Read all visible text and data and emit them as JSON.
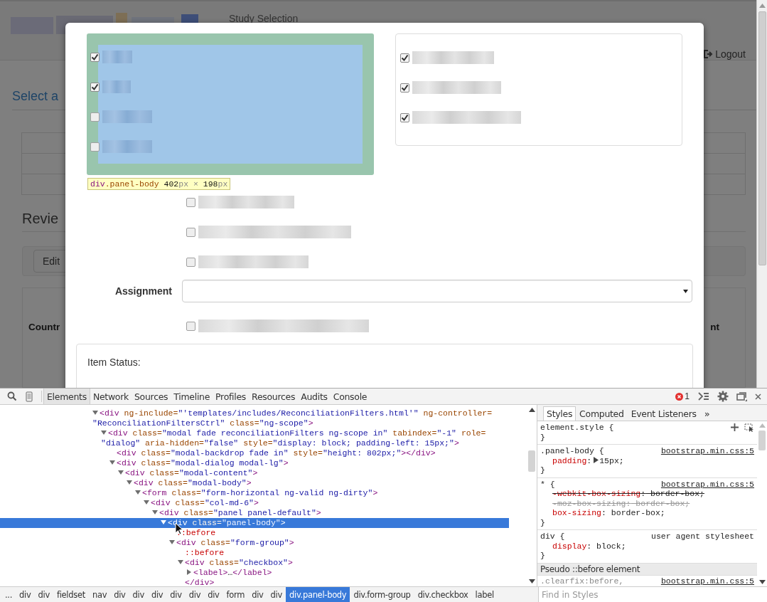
{
  "page": {
    "header": {
      "title": "Study Selection",
      "logout": "Logout"
    },
    "heading": "Select a",
    "section_title": "Revie",
    "edit_button": "Edit",
    "table": {
      "columns": [
        {
          "label": "Countr"
        },
        {
          "label": "nt"
        }
      ]
    }
  },
  "modal": {
    "left_panel": {
      "items": [
        {
          "checked": true
        },
        {
          "checked": true
        },
        {
          "checked": false
        },
        {
          "checked": false
        }
      ]
    },
    "highlight_tooltip": {
      "parts": [
        {
          "kind": "tag",
          "text": "div"
        },
        {
          "kind": "class",
          "text": ".panel-body "
        },
        {
          "kind": "number",
          "text": "402"
        },
        {
          "kind": "unit",
          "text": "px × "
        },
        {
          "kind": "number",
          "text": "198"
        },
        {
          "kind": "unit",
          "text": "px"
        }
      ]
    },
    "right_panel": {
      "items": [
        {
          "checked": true
        },
        {
          "checked": true
        },
        {
          "checked": true
        }
      ]
    },
    "options": [
      {
        "checked": false
      },
      {
        "checked": false
      },
      {
        "checked": false
      }
    ],
    "assignment": {
      "label": "Assignment"
    },
    "extra_option": {
      "checked": false
    },
    "item_status": {
      "label": "Item Status:"
    }
  },
  "devtools": {
    "tabs": [
      {
        "label": "Elements",
        "selected": true
      },
      {
        "label": "Network",
        "selected": false
      },
      {
        "label": "Sources",
        "selected": false
      },
      {
        "label": "Timeline",
        "selected": false
      },
      {
        "label": "Profiles",
        "selected": false
      },
      {
        "label": "Resources",
        "selected": false
      },
      {
        "label": "Audits",
        "selected": false
      },
      {
        "label": "Console",
        "selected": false
      }
    ],
    "error_count": "1",
    "dom_tree": [
      {
        "kind": "element",
        "expanded": true,
        "selected": false,
        "tokens": [
          {
            "kind": "tag",
            "text": "<div"
          },
          {
            "kind": "attr",
            "text": " ng-include="
          },
          {
            "kind": "value",
            "text": "\"'templates/includes/ReconciliationFilters.html'\""
          },
          {
            "kind": "attr",
            "text": " ng-controller="
          },
          {
            "kind": "value",
            "text": "\"ReconciliationFiltersCtrl\""
          },
          {
            "kind": "attr",
            "text": " class="
          },
          {
            "kind": "value",
            "text": "\"ng-scope\""
          },
          {
            "kind": "tag",
            "text": ">"
          }
        ],
        "children": [
          {
            "kind": "element",
            "expanded": true,
            "selected": false,
            "tokens": [
              {
                "kind": "tag",
                "text": "<div"
              },
              {
                "kind": "attr",
                "text": " class="
              },
              {
                "kind": "value",
                "text": "\"modal fade reconciliationFilters ng-scope in\""
              },
              {
                "kind": "attr",
                "text": " tabindex="
              },
              {
                "kind": "value",
                "text": "\"-1\""
              },
              {
                "kind": "attr",
                "text": " role="
              },
              {
                "kind": "value",
                "text": "\"dialog\""
              },
              {
                "kind": "attr",
                "text": " aria-hidden="
              },
              {
                "kind": "value",
                "text": "\"false\""
              },
              {
                "kind": "attr",
                "text": " style="
              },
              {
                "kind": "value",
                "text": "\"display: block; padding-left: 15px;\""
              },
              {
                "kind": "tag",
                "text": ">"
              }
            ],
            "children": [
              {
                "kind": "leaf",
                "selected": false,
                "tokens": [
                  {
                    "kind": "tag",
                    "text": "<div"
                  },
                  {
                    "kind": "attr",
                    "text": " class="
                  },
                  {
                    "kind": "value",
                    "text": "\"modal-backdrop fade in\""
                  },
                  {
                    "kind": "attr",
                    "text": " style="
                  },
                  {
                    "kind": "value",
                    "text": "\"height: 802px;\""
                  },
                  {
                    "kind": "tag",
                    "text": "></div>"
                  }
                ]
              },
              {
                "kind": "element",
                "expanded": true,
                "selected": false,
                "tokens": [
                  {
                    "kind": "tag",
                    "text": "<div"
                  },
                  {
                    "kind": "attr",
                    "text": " class="
                  },
                  {
                    "kind": "value",
                    "text": "\"modal-dialog modal-lg\""
                  },
                  {
                    "kind": "tag",
                    "text": ">"
                  }
                ],
                "children": [
                  {
                    "kind": "element",
                    "expanded": true,
                    "selected": false,
                    "tokens": [
                      {
                        "kind": "tag",
                        "text": "<div"
                      },
                      {
                        "kind": "attr",
                        "text": " class="
                      },
                      {
                        "kind": "value",
                        "text": "\"modal-content\""
                      },
                      {
                        "kind": "tag",
                        "text": ">"
                      }
                    ],
                    "children": [
                      {
                        "kind": "element",
                        "expanded": true,
                        "selected": false,
                        "tokens": [
                          {
                            "kind": "tag",
                            "text": "<div"
                          },
                          {
                            "kind": "attr",
                            "text": " class="
                          },
                          {
                            "kind": "value",
                            "text": "\"modal-body\""
                          },
                          {
                            "kind": "tag",
                            "text": ">"
                          }
                        ],
                        "children": [
                          {
                            "kind": "element",
                            "expanded": true,
                            "selected": false,
                            "tokens": [
                              {
                                "kind": "tag",
                                "text": "<form"
                              },
                              {
                                "kind": "attr",
                                "text": " class="
                              },
                              {
                                "kind": "value",
                                "text": "\"form-horizontal ng-valid ng-dirty\""
                              },
                              {
                                "kind": "tag",
                                "text": ">"
                              }
                            ],
                            "children": [
                              {
                                "kind": "element",
                                "expanded": true,
                                "selected": false,
                                "tokens": [
                                  {
                                    "kind": "tag",
                                    "text": "<div"
                                  },
                                  {
                                    "kind": "attr",
                                    "text": " class="
                                  },
                                  {
                                    "kind": "value",
                                    "text": "\"col-md-6\""
                                  },
                                  {
                                    "kind": "tag",
                                    "text": ">"
                                  }
                                ],
                                "children": [
                                  {
                                    "kind": "element",
                                    "expanded": true,
                                    "selected": false,
                                    "tokens": [
                                      {
                                        "kind": "tag",
                                        "text": "<div"
                                      },
                                      {
                                        "kind": "attr",
                                        "text": " class="
                                      },
                                      {
                                        "kind": "value",
                                        "text": "\"panel panel-default\""
                                      },
                                      {
                                        "kind": "tag",
                                        "text": ">"
                                      }
                                    ],
                                    "children": [
                                      {
                                        "kind": "element",
                                        "expanded": true,
                                        "selected": true,
                                        "tokens": [
                                          {
                                            "kind": "tag",
                                            "text": "<div"
                                          },
                                          {
                                            "kind": "attr",
                                            "text": " class="
                                          },
                                          {
                                            "kind": "value",
                                            "text": "\"panel-body\""
                                          },
                                          {
                                            "kind": "tag",
                                            "text": ">"
                                          }
                                        ],
                                        "children": [
                                          {
                                            "kind": "leaf",
                                            "selected": false,
                                            "tokens": [
                                              {
                                                "kind": "pseudo",
                                                "text": "::before"
                                              }
                                            ]
                                          },
                                          {
                                            "kind": "element",
                                            "expanded": true,
                                            "selected": false,
                                            "tokens": [
                                              {
                                                "kind": "tag",
                                                "text": "<div"
                                              },
                                              {
                                                "kind": "attr",
                                                "text": " class="
                                              },
                                              {
                                                "kind": "value",
                                                "text": "\"form-group\""
                                              },
                                              {
                                                "kind": "tag",
                                                "text": ">"
                                              }
                                            ],
                                            "children": [
                                              {
                                                "kind": "leaf",
                                                "selected": false,
                                                "tokens": [
                                                  {
                                                    "kind": "pseudo",
                                                    "text": "::before"
                                                  }
                                                ]
                                              },
                                              {
                                                "kind": "element",
                                                "expanded": true,
                                                "selected": false,
                                                "tokens": [
                                                  {
                                                    "kind": "tag",
                                                    "text": "<div"
                                                  },
                                                  {
                                                    "kind": "attr",
                                                    "text": " class="
                                                  },
                                                  {
                                                    "kind": "value",
                                                    "text": "\"checkbox\""
                                                  },
                                                  {
                                                    "kind": "tag",
                                                    "text": ">"
                                                  }
                                                ],
                                                "close": [
                                                  {
                                                    "kind": "tag",
                                                    "text": "</div>"
                                                  }
                                                ],
                                                "children": [
                                                  {
                                                    "kind": "element",
                                                    "expanded": false,
                                                    "selected": false,
                                                    "tokens": [
                                                      {
                                                        "kind": "tag",
                                                        "text": "<label>"
                                                      },
                                                      {
                                                        "kind": "text",
                                                        "text": "…"
                                                      },
                                                      {
                                                        "kind": "tag",
                                                        "text": "</label>"
                                                      }
                                                    ]
                                                  }
                                                ]
                                              }
                                            ]
                                          }
                                        ]
                                      }
                                    ]
                                  }
                                ]
                              }
                            ]
                          }
                        ]
                      }
                    ]
                  }
                ]
              }
            ]
          }
        ]
      }
    ],
    "breadcrumbs": [
      {
        "label": "...",
        "selected": false
      },
      {
        "label": "div",
        "selected": false
      },
      {
        "label": "div",
        "selected": false
      },
      {
        "label": "fieldset",
        "selected": false
      },
      {
        "label": "nav",
        "selected": false
      },
      {
        "label": "div",
        "selected": false
      },
      {
        "label": "div",
        "selected": false
      },
      {
        "label": "div",
        "selected": false
      },
      {
        "label": "div",
        "selected": false
      },
      {
        "label": "div",
        "selected": false
      },
      {
        "label": "div",
        "selected": false
      },
      {
        "label": "form",
        "selected": false
      },
      {
        "label": "div",
        "selected": false
      },
      {
        "label": "div",
        "selected": false
      },
      {
        "label": "div.panel-body",
        "selected": true
      },
      {
        "label": "div.form-group",
        "selected": false
      },
      {
        "label": "div.checkbox",
        "selected": false
      },
      {
        "label": "label",
        "selected": false
      }
    ],
    "styles_tabs": [
      {
        "label": "Styles",
        "selected": true
      },
      {
        "label": "Computed",
        "selected": false
      },
      {
        "label": "Event Listeners",
        "selected": false
      }
    ],
    "styles_more": "»",
    "rules": [
      {
        "header": "element.style {",
        "tools": true,
        "footer": "}"
      },
      {
        "header": ".panel-body {",
        "source": "bootstrap.min.css:5",
        "underlined": true,
        "declarations": [
          {
            "name": "padding",
            "colon": ":",
            "value": "15px;",
            "expandable": true,
            "struck": false,
            "invalid": false
          }
        ],
        "footer": "}"
      },
      {
        "header": "* {",
        "source": "bootstrap.min.css:5",
        "underlined": true,
        "declarations": [
          {
            "name": "-webkit-box-sizing",
            "colon": ":",
            "value": " border-box;",
            "expandable": false,
            "struck": true,
            "invalid": false
          },
          {
            "name": "-moz-box-sizing",
            "colon": ":",
            "value": " border-box;",
            "expandable": false,
            "struck": true,
            "invalid": true
          },
          {
            "name": "box-sizing",
            "colon": ":",
            "value": " border-box;",
            "expandable": false,
            "struck": false,
            "invalid": false
          }
        ],
        "footer": "}"
      },
      {
        "header": "div {",
        "source": "user agent stylesheet",
        "underlined": false,
        "declarations": [
          {
            "name": "display",
            "colon": ":",
            "value": " block;",
            "expandable": false,
            "struck": false,
            "invalid": false
          }
        ],
        "footer": "}"
      }
    ],
    "pseudo_header": "Pseudo ::before element",
    "pseudo_rule": {
      "header": ".clearfix:before,",
      "source": "bootstrap.min.css:5"
    },
    "filter": {
      "placeholder": "Find in Styles"
    }
  }
}
